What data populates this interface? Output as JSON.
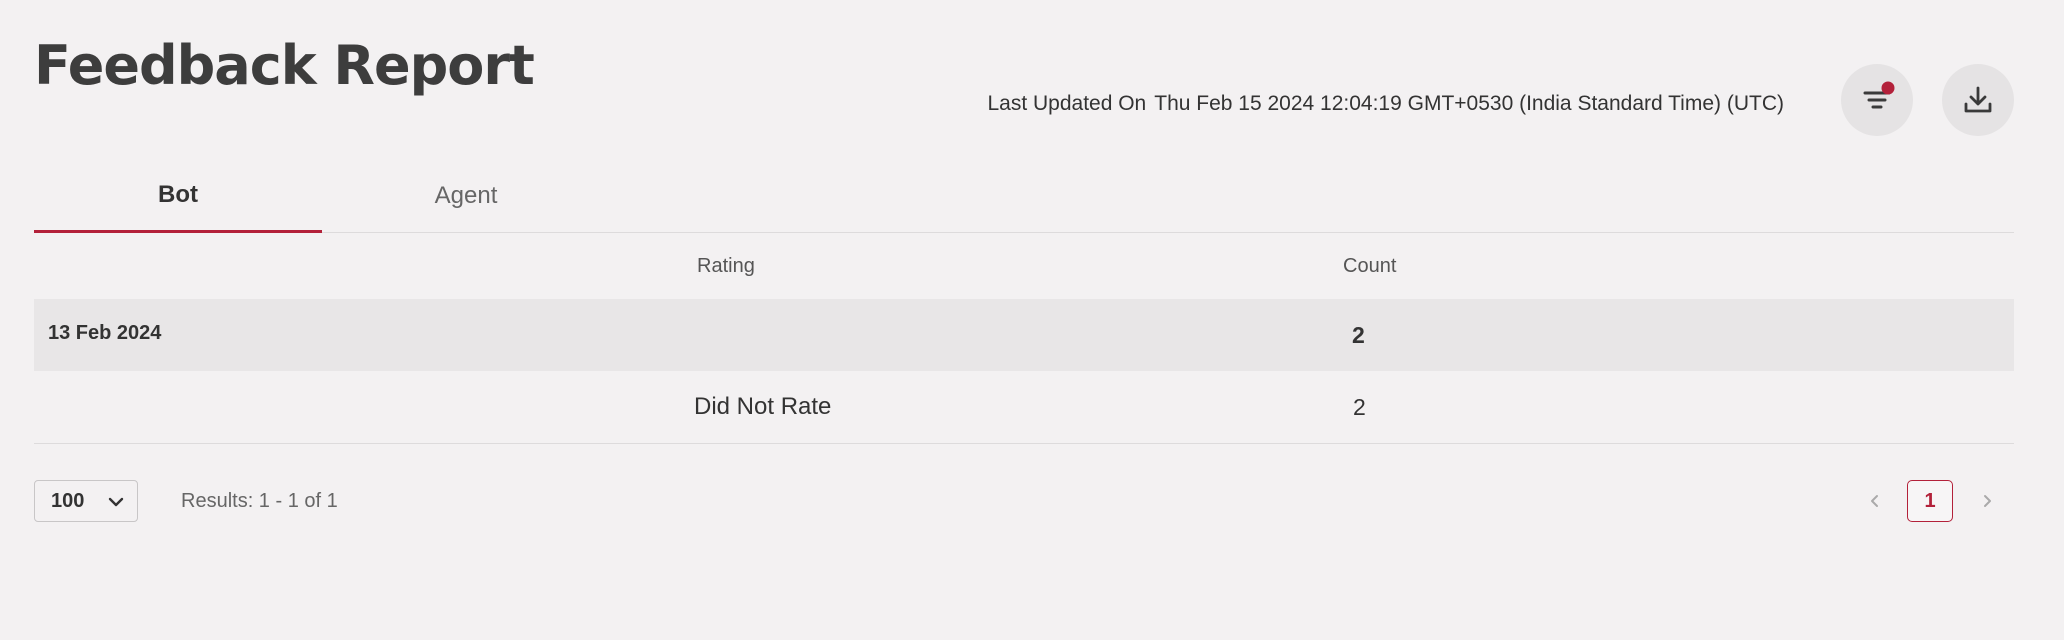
{
  "header": {
    "title": "Feedback Report",
    "last_updated_label": "Last Updated On",
    "last_updated_value": "Thu Feb 15 2024 12:04:19 GMT+0530 (India Standard Time) (UTC)",
    "filter_icon": "filter-icon",
    "download_icon": "download-icon",
    "accent_color": "#b3213a"
  },
  "tabs": [
    {
      "label": "Bot",
      "active": true
    },
    {
      "label": "Agent",
      "active": false
    }
  ],
  "table": {
    "columns": [
      "Rating",
      "Count"
    ],
    "groups": [
      {
        "date": "13 Feb 2024",
        "total": "2",
        "rows": [
          {
            "rating": "Did Not Rate",
            "count": "2"
          }
        ]
      }
    ]
  },
  "footer": {
    "page_size": "100",
    "results_text": "Results: 1 - 1 of 1",
    "current_page": "1"
  }
}
